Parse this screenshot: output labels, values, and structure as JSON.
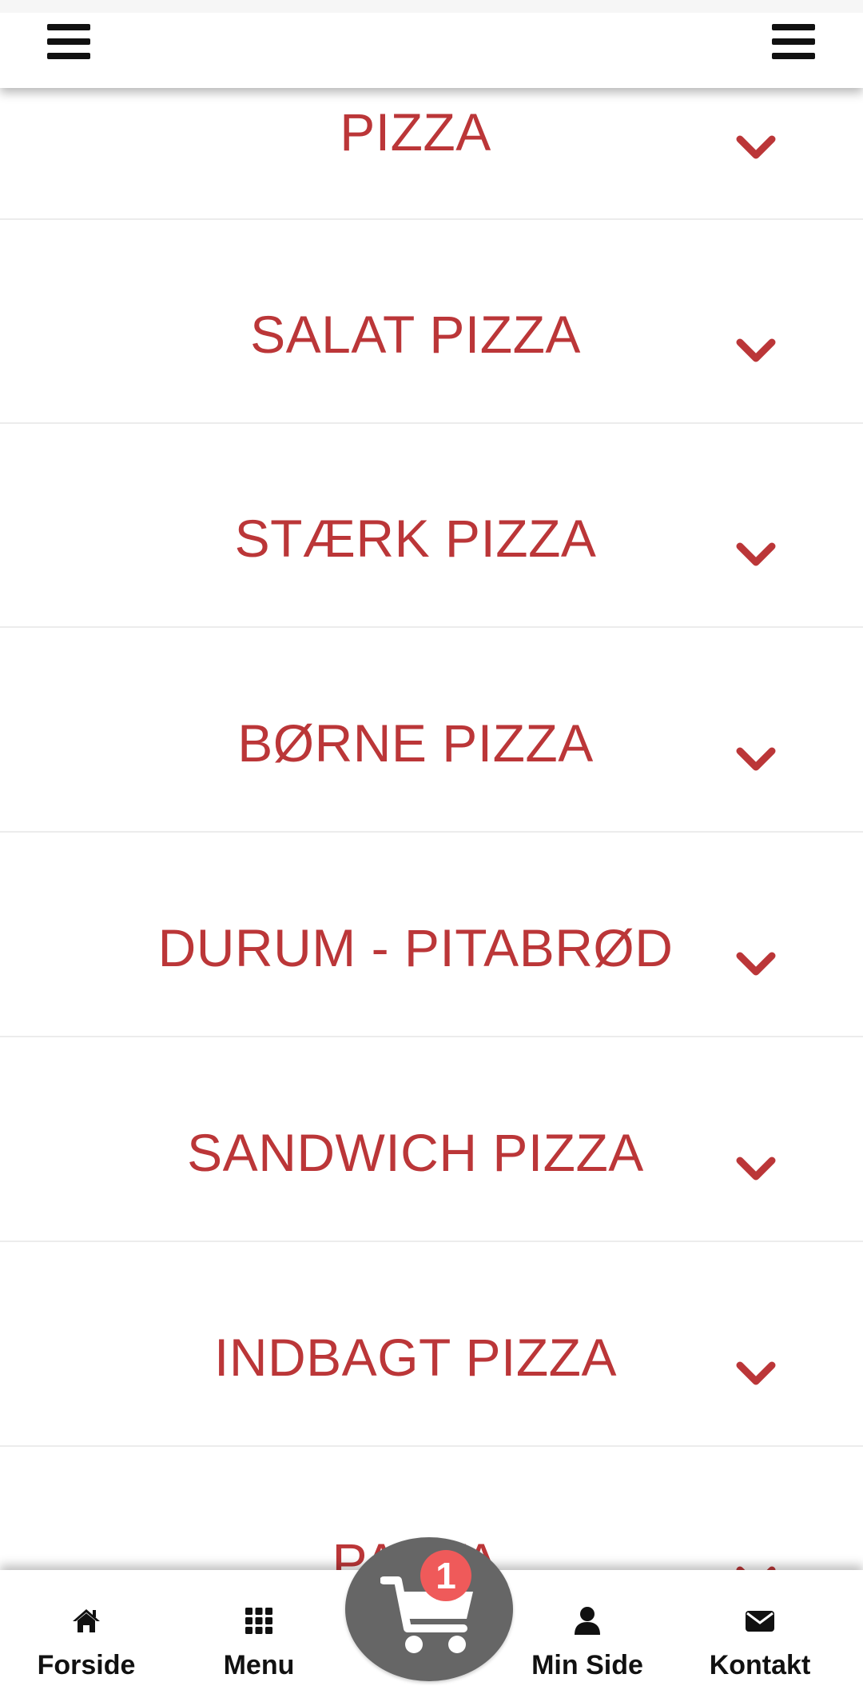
{
  "colors": {
    "accent": "#bb3638",
    "cart": "#666666",
    "badge": "#ef5a5a"
  },
  "header": {
    "left_menu_icon": "hamburger-icon",
    "right_menu_icon": "hamburger-icon"
  },
  "categories": [
    {
      "label": "PIZZA",
      "icon": "chevron-down-icon"
    },
    {
      "label": "SALAT PIZZA",
      "icon": "chevron-down-icon"
    },
    {
      "label": "STÆRK PIZZA",
      "icon": "chevron-down-icon"
    },
    {
      "label": "BØRNE PIZZA",
      "icon": "chevron-down-icon"
    },
    {
      "label": "DURUM - PITABRØD",
      "icon": "chevron-down-icon"
    },
    {
      "label": "SANDWICH PIZZA",
      "icon": "chevron-down-icon"
    },
    {
      "label": "INDBAGT PIZZA",
      "icon": "chevron-down-icon"
    },
    {
      "label": "PASTA",
      "icon": "chevron-down-icon"
    }
  ],
  "bottom_nav": {
    "items": [
      {
        "label": "Forside",
        "icon": "home-icon"
      },
      {
        "label": "Menu",
        "icon": "grid-icon"
      },
      {
        "label": "Min Side",
        "icon": "user-icon"
      },
      {
        "label": "Kontakt",
        "icon": "envelope-icon"
      }
    ],
    "cart": {
      "icon": "cart-icon",
      "count": "1"
    }
  }
}
